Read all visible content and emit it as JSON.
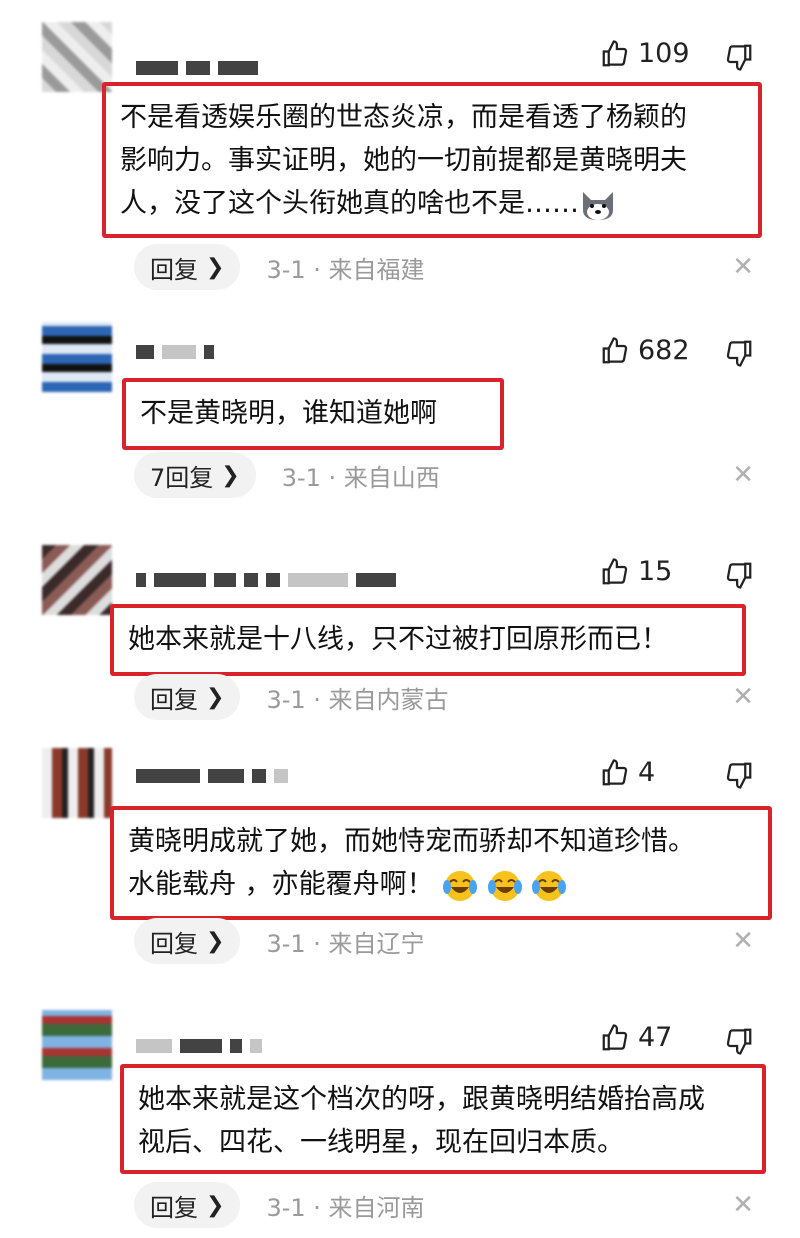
{
  "comments": [
    {
      "likes": "109",
      "lines": [
        "不是看透娱乐圈的世态炎凉，而是看透了杨颖的",
        "影响力。事实证明，她的一切前提都是黄晓明夫",
        "人，没了这个头衔她真的啥也不是……"
      ],
      "reply_label": "回复",
      "meta": "3-1 · 来自福建"
    },
    {
      "likes": "682",
      "lines": [
        "不是黄晓明，谁知道她啊"
      ],
      "reply_label": "7回复",
      "meta": "3-1 · 来自山西"
    },
    {
      "likes": "15",
      "lines": [
        "她本来就是十八线，只不过被打回原形而已！"
      ],
      "reply_label": "回复",
      "meta": "3-1 · 来自内蒙古"
    },
    {
      "likes": "4",
      "lines": [
        "黄晓明成就了她，而她恃宠而骄却不知道珍惜。",
        "水能载舟 ，亦能覆舟啊！"
      ],
      "reply_label": "回复",
      "meta": "3-1 · 来自辽宁"
    },
    {
      "likes": "47",
      "lines": [
        "她本来就是这个档次的呀，跟黄晓明结婚抬高成",
        "视后、四花、一线明星，现在回归本质。"
      ],
      "reply_label": "回复",
      "meta": "3-1 · 来自河南"
    }
  ],
  "icons": {
    "like": "thumbs-up-icon",
    "dislike": "thumbs-down-icon",
    "close": "close-icon",
    "chevron": "chevron-right-icon",
    "cat_emoji": "husky-emoji",
    "crying_emoji": "crying-laughing-emoji"
  },
  "colors": {
    "highlight_border": "#d8232a",
    "meta_text": "#9a9a9a",
    "reply_bg": "#f2f2f2"
  }
}
